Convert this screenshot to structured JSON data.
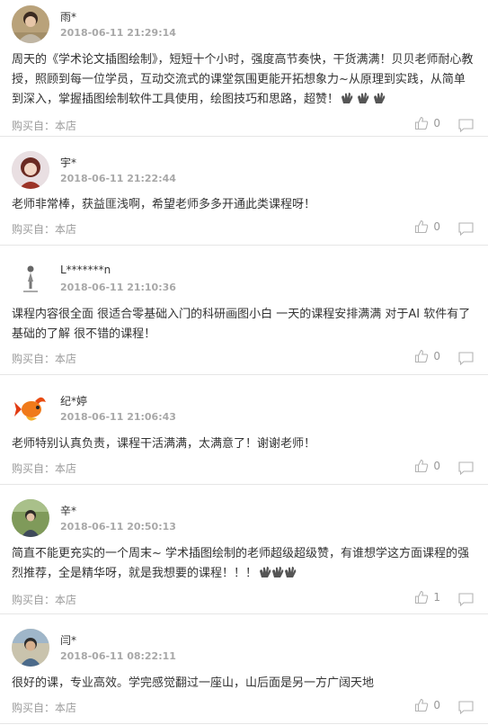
{
  "reviews": [
    {
      "user": "雨*",
      "time": "2018-06-11 21:29:14",
      "content": "周天的《学术论文插图绘制》，短短十个小时，强度高节奏快，干货满满！贝贝老师耐心教授，照顾到每一位学员，互动交流式的课堂氛围更能开拓想象力~从原理到实践，从简单到深入，掌握插图绘制软件工具使用，绘图技巧和思路，超赞！",
      "emoji": "clapping-hands-emoji x3",
      "bought": "购买自：本店",
      "likes": "0",
      "avatar": "woman-photo-avatar"
    },
    {
      "user": "宇*",
      "time": "2018-06-11 21:22:44",
      "content": "老师非常棒，获益匪浅啊，希望老师多多开通此类课程呀！",
      "bought": "购买自：本店",
      "likes": "0",
      "avatar": "character-avatar"
    },
    {
      "user": "L*******n",
      "time": "2018-06-11 21:10:36",
      "content": "课程内容很全面 很适合零基础入门的科研画图小白 一天的课程安排满满 对于AI 软件有了基础的了解 很不错的课程！",
      "bought": "购买自：本店",
      "likes": "0",
      "avatar": "figure-logo-avatar"
    },
    {
      "user": "纪*婷",
      "time": "2018-06-11 21:06:43",
      "content": "老师特别认真负责，课程干活满满，太满意了！谢谢老师！",
      "bought": "购买自：本店",
      "likes": "0",
      "avatar": "goldfish-avatar"
    },
    {
      "user": "辛*",
      "time": "2018-06-11 20:50:13",
      "content": "简直不能更充实的一个周末~ 学术插图绘制的老师超级超级赞，有谁想学这方面课程的强烈推荐，全是精华呀，就是我想要的课程！！！",
      "emoji": "clapping-hands-emoji x3",
      "bought": "购买自：本店",
      "likes": "1",
      "avatar": "outdoor-photo-avatar"
    },
    {
      "user": "闫*",
      "time": "2018-06-11 08:22:11",
      "content": "很好的课，专业高效。学完感觉翻过一座山，山后面是另一方广阔天地",
      "bought": "购买自：本店",
      "likes": "0",
      "avatar": "man-photo-avatar"
    }
  ],
  "colors": {
    "text": "#333333",
    "time": "#a8a8a8",
    "muted": "#9b9b9b",
    "divider": "#e6e6e6"
  }
}
